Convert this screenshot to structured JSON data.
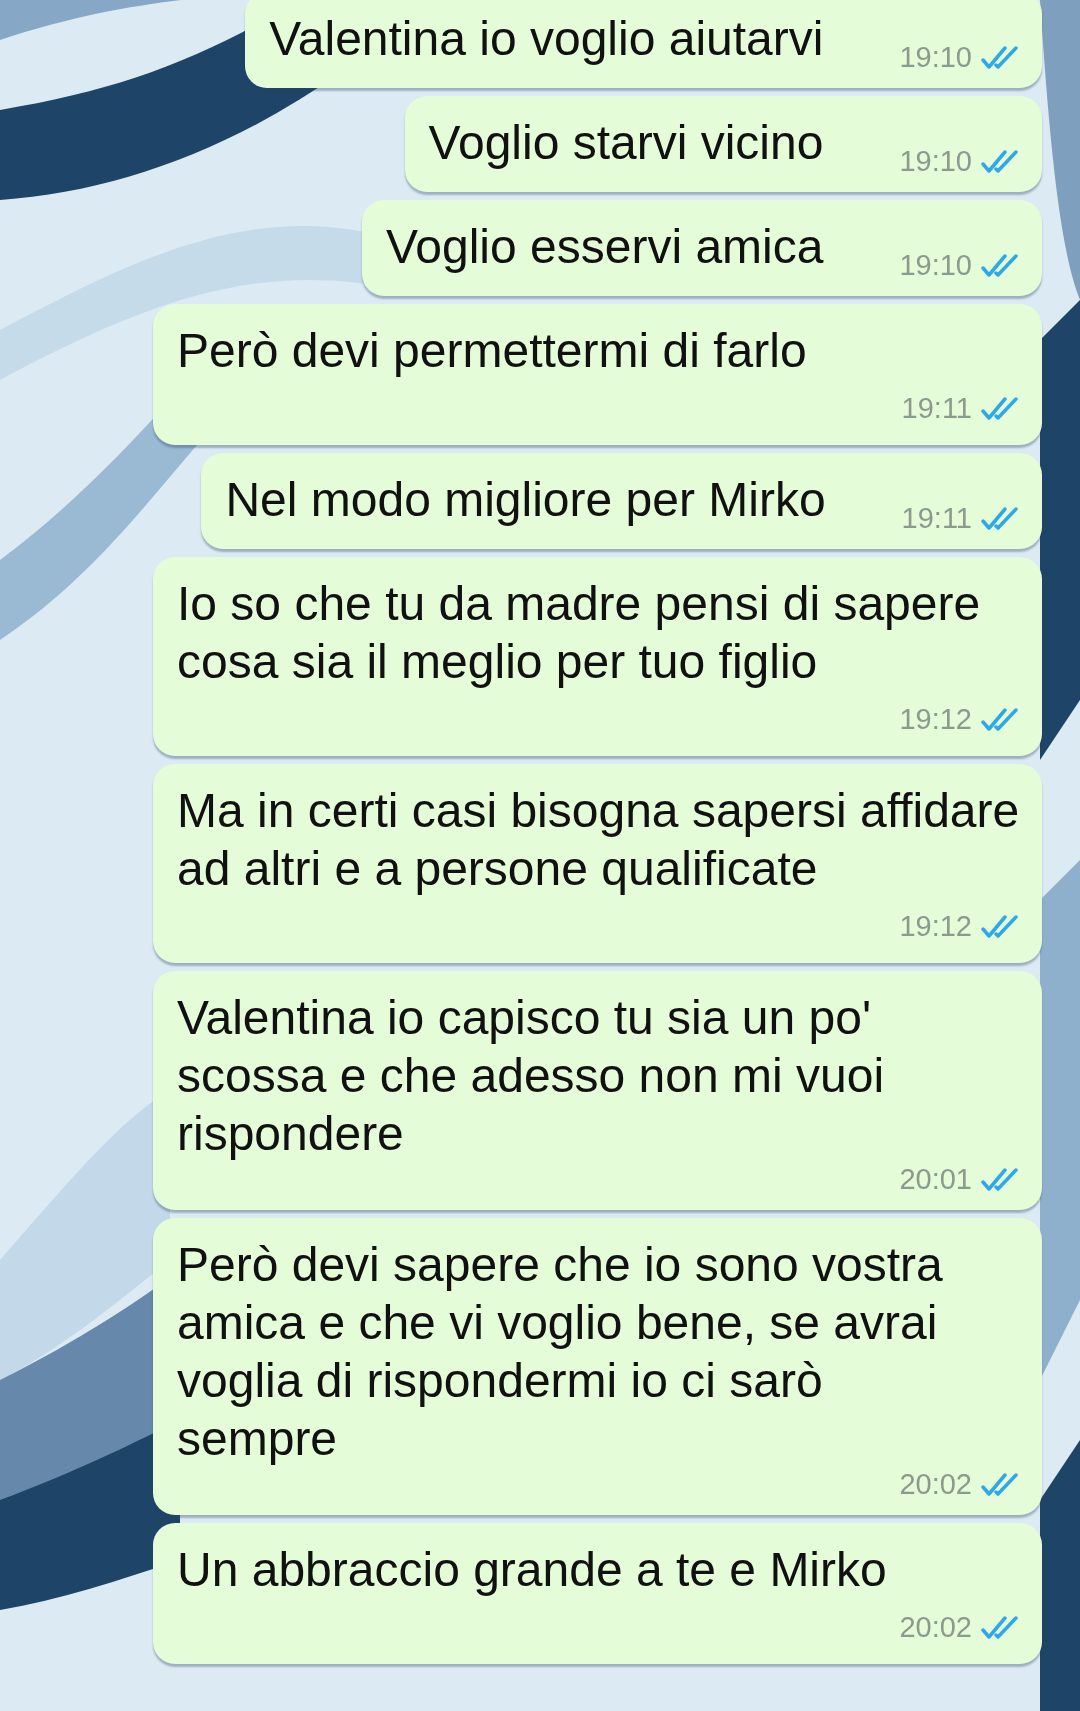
{
  "messages": [
    {
      "kind": "inline",
      "text": "Valentina io voglio aiutarvi",
      "time": "19:10",
      "read": true
    },
    {
      "kind": "inline",
      "text": "Voglio starvi vicino",
      "time": "19:10",
      "read": true
    },
    {
      "kind": "inline",
      "text": "Voglio esservi amica",
      "time": "19:10",
      "read": true
    },
    {
      "kind": "stacked",
      "text": "Però devi permettermi di farlo",
      "time": "19:11",
      "read": true
    },
    {
      "kind": "inline",
      "text": "Nel modo migliore per Mirko",
      "time": "19:11",
      "read": true
    },
    {
      "kind": "stacked",
      "text": "Io so che tu da madre pensi di sapere cosa sia il meglio per tuo figlio",
      "time": "19:12",
      "read": true
    },
    {
      "kind": "stacked",
      "text": "Ma in certi casi bisogna sapersi affidare ad altri e a persone qualificate",
      "time": "19:12",
      "read": true
    },
    {
      "kind": "trailing",
      "text": "Valentina io capisco tu sia un po' scossa e che adesso non mi vuoi rispondere",
      "time": "20:01",
      "read": true
    },
    {
      "kind": "trailing",
      "text": "Però devi sapere che io sono vostra amica e che vi voglio bene, se avrai voglia di rispondermi io ci sarò sempre",
      "time": "20:02",
      "read": true
    },
    {
      "kind": "stacked",
      "text": "Un abbraccio grande a te e Mirko",
      "time": "20:02",
      "read": true
    }
  ]
}
